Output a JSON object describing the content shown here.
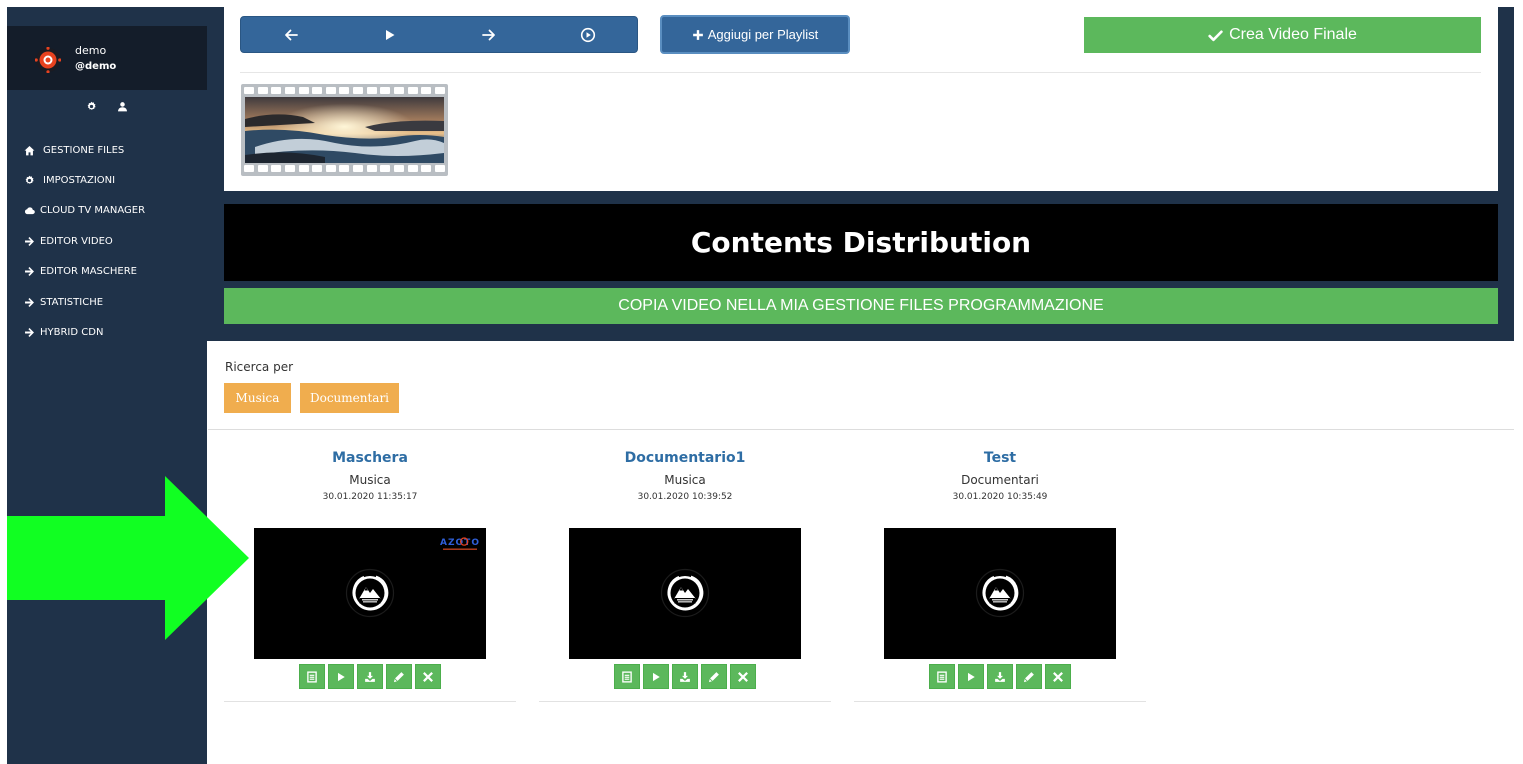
{
  "colors": {
    "sidebar": "#1f3249",
    "sidebar_header": "#141d2a",
    "blue_button": "#34669a",
    "green": "#5cb85c",
    "orange": "#f0ad4e",
    "link_blue": "#2e6da4",
    "arrow": "#11ff22"
  },
  "user": {
    "name": "demo",
    "handle": "@demo"
  },
  "sidebar": {
    "top_icons": [
      "gear-icon",
      "user-icon"
    ],
    "items": [
      {
        "label": "GESTIONE FILES",
        "icon": "home-icon"
      },
      {
        "label": "IMPOSTAZIONI",
        "icon": "gear-icon"
      },
      {
        "label": "CLOUD TV MANAGER",
        "icon": "cloud-icon"
      },
      {
        "label": "EDITOR VIDEO",
        "icon": "arrow-right-icon"
      },
      {
        "label": "EDITOR MASCHERE",
        "icon": "arrow-right-icon"
      },
      {
        "label": "STATISTICHE",
        "icon": "arrow-right-icon"
      },
      {
        "label": "HYBRID CDN",
        "icon": "arrow-right-icon"
      }
    ]
  },
  "toolbar": {
    "controls": [
      "arrow-left-icon",
      "play-icon",
      "arrow-right-icon",
      "play-circle-icon"
    ],
    "add_playlist_label": "Aggiugi per Playlist",
    "create_final_label": "Crea Video Finale"
  },
  "section": {
    "title": "Contents Distribution",
    "copy_label": "COPIA VIDEO NELLA MIA GESTIONE FILES PROGRAMMAZIONE"
  },
  "search": {
    "label": "Ricerca per",
    "tags": [
      "Musica",
      "Documentari"
    ]
  },
  "cards": [
    {
      "title": "Maschera",
      "category": "Musica",
      "date": "30.01.2020 11:35:17",
      "watermark": "AZOTO"
    },
    {
      "title": "Documentario1",
      "category": "Musica",
      "date": "30.01.2020 10:39:52"
    },
    {
      "title": "Test",
      "category": "Documentari",
      "date": "30.01.2020 10:35:49"
    }
  ],
  "card_actions": [
    "list-icon",
    "play-icon",
    "download-icon",
    "pencil-icon",
    "close-icon"
  ]
}
